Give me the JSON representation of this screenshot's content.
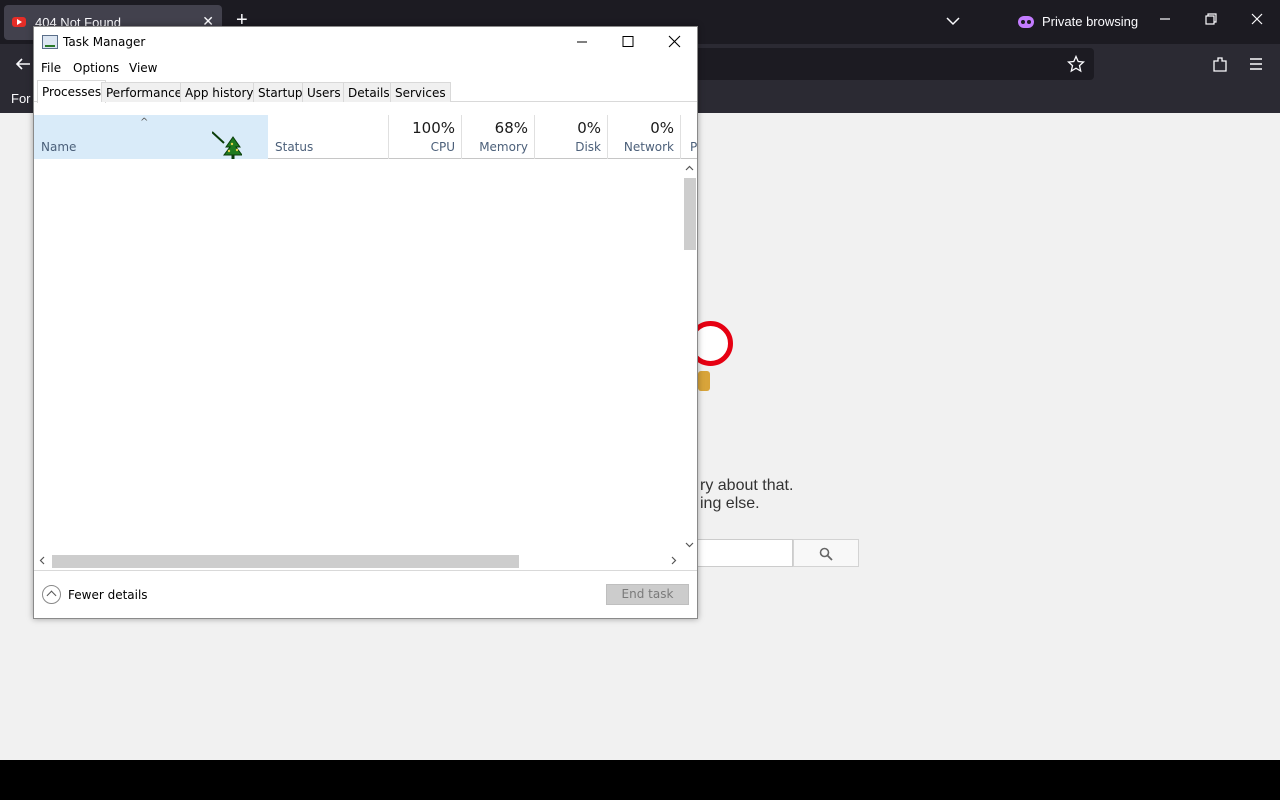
{
  "browser": {
    "tab_title": "404 Not Found",
    "tab_close": "✕",
    "new_tab": "+",
    "private_label": "Private browsing",
    "bookmarks_item": "For",
    "brand_color": "#e60012"
  },
  "page": {
    "error_line1": "ry about that.",
    "error_line2": "ing else."
  },
  "task_manager": {
    "title": "Task Manager",
    "menu": [
      "File",
      "Options",
      "View"
    ],
    "tabs": [
      "Processes",
      "Performance",
      "App history",
      "Startup",
      "Users",
      "Details",
      "Services"
    ],
    "active_tab": "Processes",
    "columns": {
      "name": "Name",
      "status": "Status",
      "cpu_pct": "100%",
      "cpu": "CPU",
      "memory_pct": "68%",
      "memory": "Memory",
      "disk_pct": "0%",
      "disk": "Disk",
      "network_pct": "0%",
      "network": "Network",
      "power_partial": "P"
    },
    "fewer_details": "Fewer details",
    "end_task": "End task"
  }
}
